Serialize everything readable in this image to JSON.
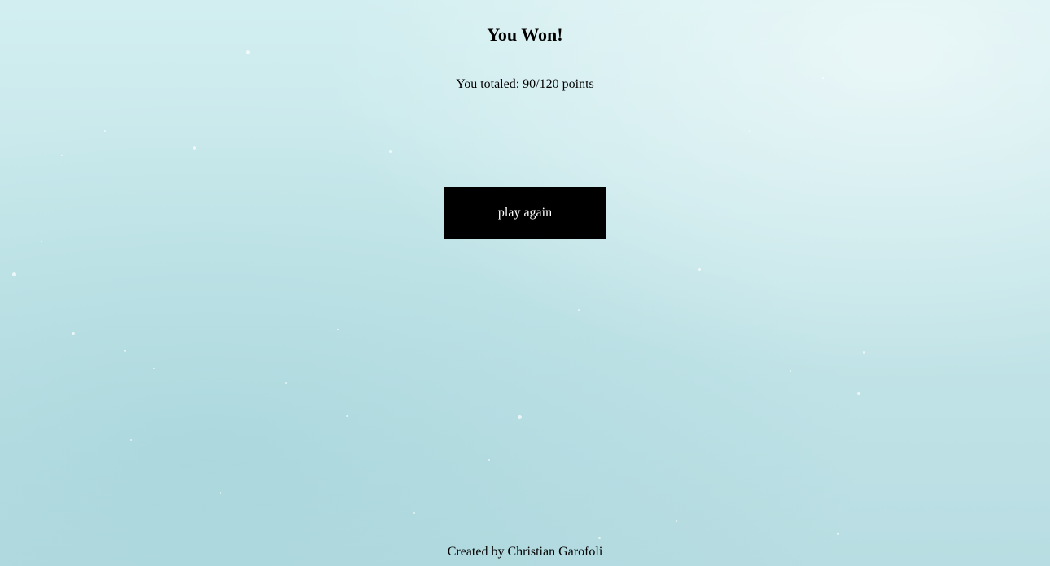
{
  "result": {
    "title": "You Won!",
    "score_label": "You totaled: ",
    "score": "90/120",
    "score_unit": " points"
  },
  "actions": {
    "play_again_label": "play again"
  },
  "footer": {
    "credit": "Created by Christian Garofoli"
  },
  "colors": {
    "background": "#c6e7ea",
    "button_bg": "#000000",
    "button_text": "#ffffff"
  }
}
